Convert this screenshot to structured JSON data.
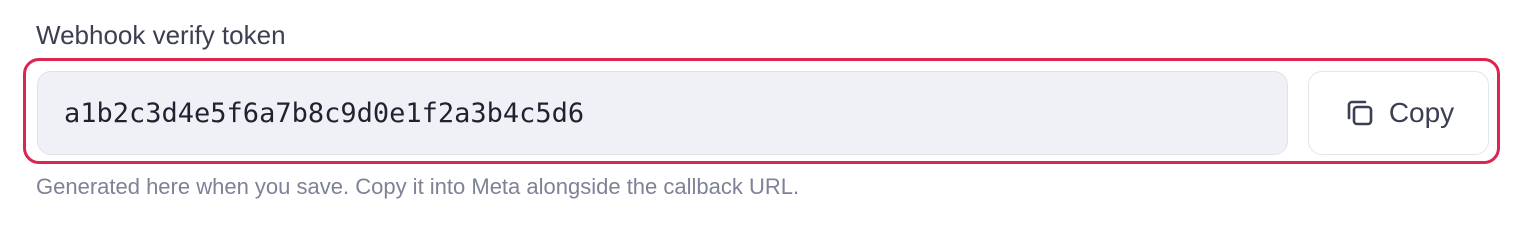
{
  "field": {
    "label": "Webhook verify token",
    "value": "a1b2c3d4e5f6a7b8c9d0e1f2a3b4c5d6",
    "helper": "Generated here when you save. Copy it into Meta alongside the callback URL."
  },
  "copy_button": {
    "label": "Copy",
    "icon": "copy-icon"
  },
  "colors": {
    "highlight": "#dc2650",
    "input_background": "#f0f1f6",
    "label_text": "#3b3f52",
    "helper_text": "#7d8296"
  }
}
